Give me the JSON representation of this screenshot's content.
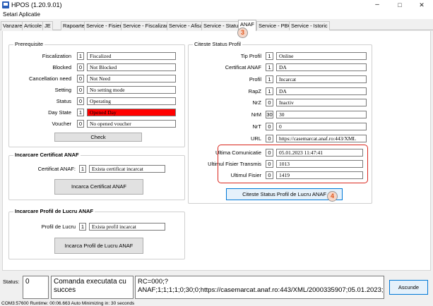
{
  "window": {
    "title": "HPOS (1.20.9.01)",
    "minimize": "–",
    "maximize": "□",
    "close": "✕"
  },
  "menu": {
    "setari": "Setari Aplicatie"
  },
  "tabs": [
    "Vanzare",
    "Articole",
    "JE",
    "Rapoarte",
    "Service - Fisiere",
    "Service - Fiscalizare",
    "Service - Afisaj",
    "Service - Status",
    "ANAF",
    "Service - PBC",
    "Service - Istoric"
  ],
  "prerequisite": {
    "title": "Prerequisite",
    "rows": [
      {
        "label": "Fiscalization",
        "code": "1",
        "value": "Fiscalized"
      },
      {
        "label": "Blocked",
        "code": "0",
        "value": "Not Blocked"
      },
      {
        "label": "Cancellation need",
        "code": "0",
        "value": "Not Need"
      },
      {
        "label": "Setting",
        "code": "0",
        "value": "No setting mode"
      },
      {
        "label": "Status",
        "code": "0",
        "value": "Operating"
      },
      {
        "label": "Day State",
        "code": "1",
        "value": "Opened Day"
      },
      {
        "label": "Voucher",
        "code": "0",
        "value": "No opened voucher"
      }
    ],
    "check_label": "Check"
  },
  "certificat": {
    "title": "Incarcare Certificat ANAF",
    "label": "Certificat ANAF:",
    "code": "1",
    "value": "Exista certificat incarcat",
    "button": "Incarca Certificat ANAF"
  },
  "profil": {
    "title": "Incarcare Profil de Lucru ANAF",
    "label": "Profil de Lucru",
    "code": "1",
    "value": "Exista profil incarcat",
    "button": "Incarca Profil de Lucru ANAF"
  },
  "citeste": {
    "title": "Citeste Status Profil",
    "rows": [
      {
        "label": "Tip Profil",
        "code": "1",
        "value": "Online"
      },
      {
        "label": "Certificat ANAF",
        "code": "1",
        "value": "DA"
      },
      {
        "label": "Profil",
        "code": "1",
        "value": "Incarcat"
      },
      {
        "label": "RapZ",
        "code": "1",
        "value": "DA"
      },
      {
        "label": "NrZ",
        "code": "0",
        "value": "Inactiv"
      },
      {
        "label": "NrM",
        "code": "30",
        "value": "30"
      },
      {
        "label": "NrT",
        "code": "0",
        "value": "0"
      },
      {
        "label": "URL",
        "code": "0",
        "value": "https://casemarcat.anaf.ro:443/XML"
      },
      {
        "label": "Ultima Comunicatie",
        "code": "0",
        "value": "05.01.2023 11:47:41"
      },
      {
        "label": "Ultimul Fisier Transmis",
        "code": "0",
        "value": "1013"
      },
      {
        "label": "Ultimul Fisier",
        "code": "0",
        "value": "1419"
      }
    ],
    "button": "Citeste Status Profil de Lucru ANAF"
  },
  "annotations": {
    "step3": "3",
    "step4": "4"
  },
  "status": {
    "label": "Status:",
    "code": "0",
    "message_line1": "Comanda executata cu",
    "message_line2": "succes",
    "response_line1": "RC=000;?",
    "response_line2": "ANAF;1;1;1;1;0;30;0;https://casemarcat.anaf.ro:443/XML/2000335907;05.01.2023;",
    "ascunde": "Ascunde"
  },
  "footer": "COM3:57600  Runtime: 00:06.663  Auto Minimizing in: 30 seconds",
  "colors": {
    "day_state_bg": "#ff0000",
    "highlight": "#d9251c",
    "badge_text": "#e2561c",
    "accent": "#0078d7"
  }
}
